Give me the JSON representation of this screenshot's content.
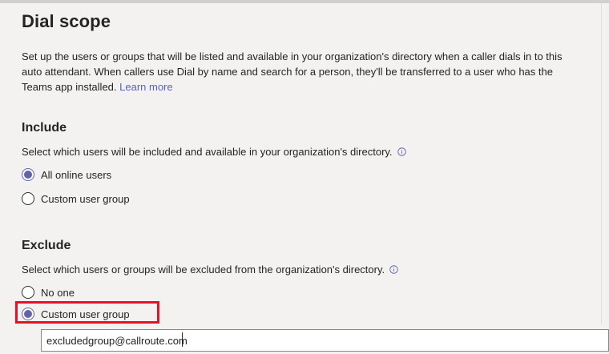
{
  "page": {
    "title": "Dial scope",
    "description": "Set up the users or groups that will be listed and available in your organization's directory when a caller dials in to this auto attendant. When callers use Dial by name and search for a person, they'll be transferred to a user who has the Teams app installed.",
    "learn_more": "Learn more"
  },
  "include": {
    "title": "Include",
    "description": "Select which users will be included and available in your organization's directory.",
    "options": [
      {
        "label": "All online users",
        "checked": true
      },
      {
        "label": "Custom user group",
        "checked": false
      }
    ]
  },
  "exclude": {
    "title": "Exclude",
    "description": "Select which users or groups will be excluded from the organization's directory.",
    "options": [
      {
        "label": "No one",
        "checked": false
      },
      {
        "label": "Custom user group",
        "checked": true
      }
    ],
    "group_field": {
      "value": "excludedgroup@callroute.com"
    }
  },
  "colors": {
    "accent": "#6264a7",
    "highlight": "#e81123",
    "link": "#5b5fc7"
  }
}
